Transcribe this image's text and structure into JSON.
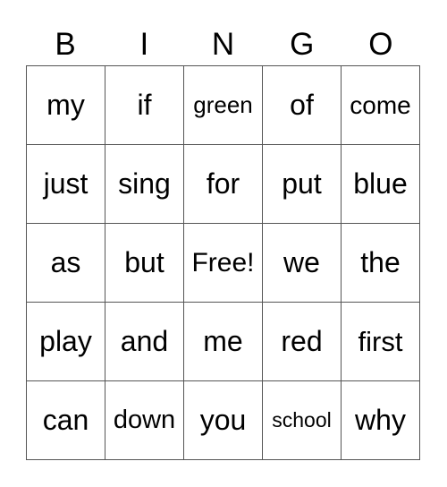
{
  "header": [
    "B",
    "I",
    "N",
    "G",
    "O"
  ],
  "cells": [
    [
      "my",
      "if",
      "green",
      "of",
      "come"
    ],
    [
      "just",
      "sing",
      "for",
      "put",
      "blue"
    ],
    [
      "as",
      "but",
      "Free!",
      "we",
      "the"
    ],
    [
      "play",
      "and",
      "me",
      "red",
      "first"
    ],
    [
      "can",
      "down",
      "you",
      "school",
      "why"
    ]
  ]
}
